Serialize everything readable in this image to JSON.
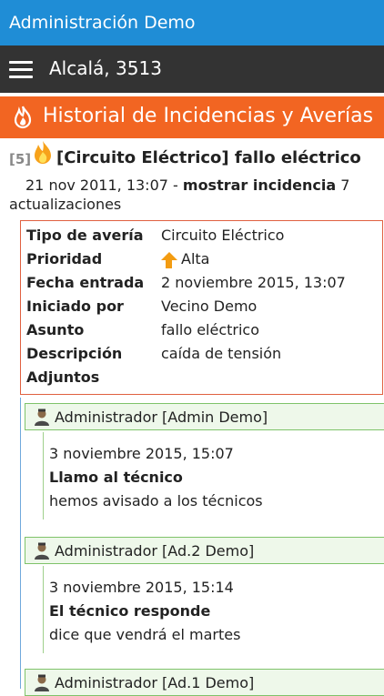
{
  "status_bar": {
    "title": "Administración Demo"
  },
  "app_bar": {
    "title": "Alcalá, 3513",
    "menu_icon": "hamburger-icon"
  },
  "section": {
    "title": "Historial de Incidencias y Averías",
    "icon": "fire-icon"
  },
  "incident": {
    "number": "[5]",
    "title": "[Circuito Eléctrico] fallo eléctrico",
    "date": "21 nov 2011, 13:07 -",
    "show_link": "mostrar incidencia",
    "updates_count": "7",
    "updates_label": "actualizaciones"
  },
  "details": [
    {
      "key": "Tipo de avería",
      "value": "Circuito Eléctrico"
    },
    {
      "key": "Prioridad",
      "value": "Alta",
      "icon": "arrow-up-icon"
    },
    {
      "key": "Fecha entrada",
      "value": "2 noviembre 2015, 13:07"
    },
    {
      "key": "Iniciado por",
      "value": "Vecino Demo"
    },
    {
      "key": "Asunto",
      "value": "fallo eléctrico"
    },
    {
      "key": "Descripción",
      "value": "caída de tensión"
    },
    {
      "key": "Adjuntos",
      "value": ""
    }
  ],
  "updates": [
    {
      "author": "Administrador [Admin Demo]",
      "date": "3 noviembre 2015, 15:07",
      "subject": "Llamo al técnico",
      "text": "hemos avisado a los técnicos"
    },
    {
      "author": "Administrador [Ad.2 Demo]",
      "date": "3 noviembre 2015, 15:14",
      "subject": "El técnico responde",
      "text": "dice que vendrá el martes"
    },
    {
      "author": "Administrador [Ad.1 Demo]"
    }
  ],
  "colors": {
    "status_bar": "#1f8dd6",
    "app_bar": "#333333",
    "section": "#f26522",
    "details_border": "#e06040",
    "update_border": "#7fc36a",
    "priority_high": "#f39c12"
  }
}
